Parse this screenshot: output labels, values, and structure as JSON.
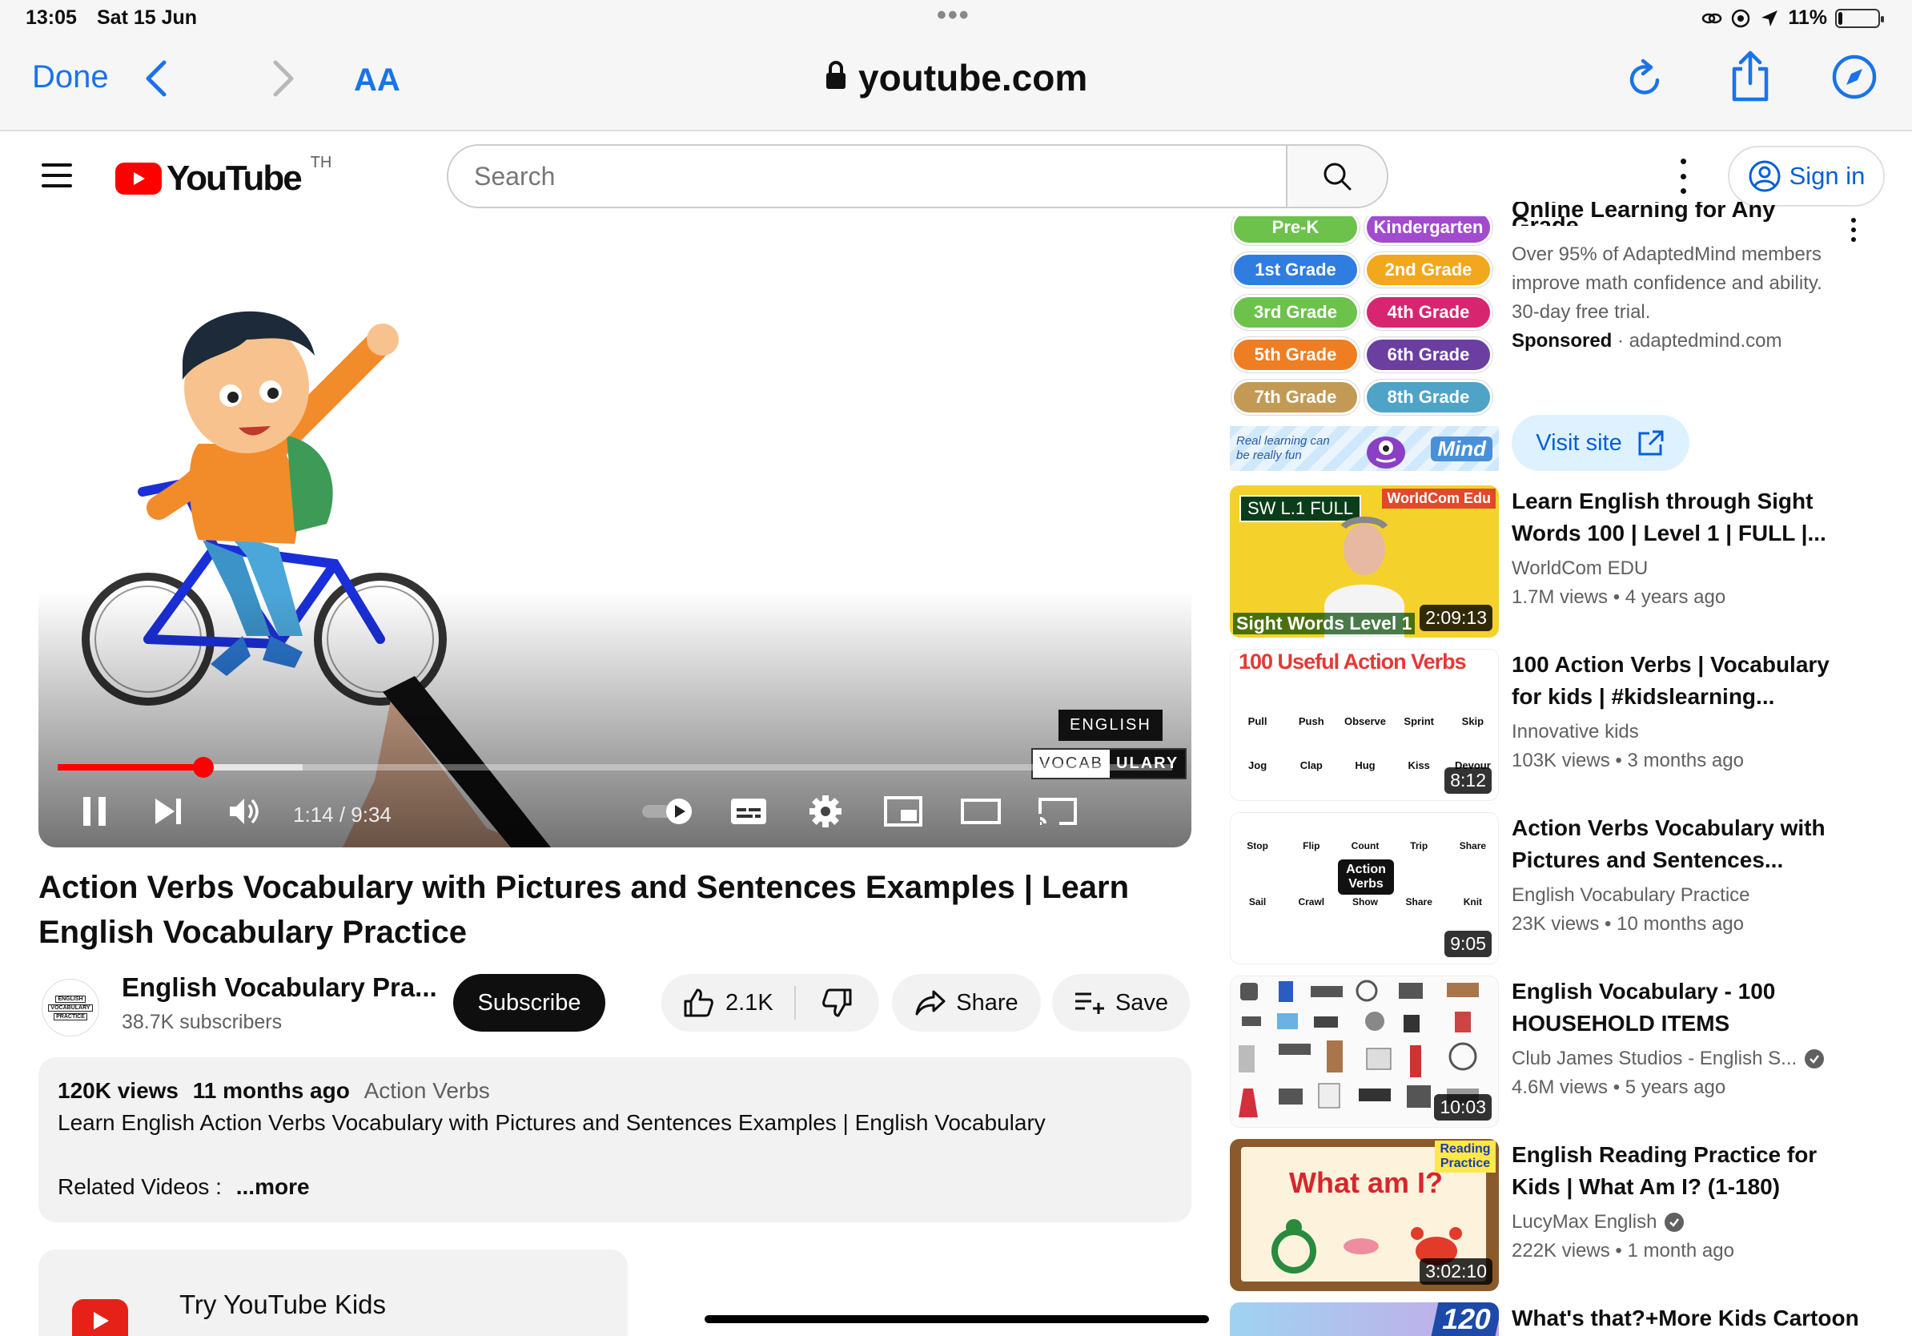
{
  "status": {
    "time": "13:05",
    "date": "Sat 15 Jun",
    "battery": "11%",
    "battery_level": 0.11
  },
  "safari": {
    "done": "Done",
    "text_size": "AA",
    "url": "youtube.com"
  },
  "yt": {
    "logo_text": "YouTube",
    "country": "TH",
    "search_placeholder": "Search",
    "sign_in": "Sign in"
  },
  "player": {
    "time": "1:14 / 9:34",
    "progress": 0.131,
    "badge_english": "ENGLISH",
    "badge_vocab_a": "VOCAB",
    "badge_vocab_b": "ULARY"
  },
  "video": {
    "title": "Action Verbs Vocabulary with Pictures and Sentences Examples | Learn English Vocabulary Practice",
    "channel": "English Vocabulary Pra...",
    "subscribers": "38.7K subscribers",
    "subscribe": "Subscribe",
    "likes": "2.1K",
    "share": "Share",
    "save": "Save",
    "views": "120K views",
    "age": "11 months ago",
    "hashtag": "Action Verbs",
    "description": "Learn English Action Verbs Vocabulary with Pictures and Sentences Examples | English Vocabulary",
    "related_label": "Related Videos :",
    "more": "...more",
    "avatar_lines": [
      "ENGLISH",
      "VOCABULARY",
      "PRACTICE"
    ]
  },
  "kids": {
    "label": "Try YouTube Kids"
  },
  "ad": {
    "title": "Online Learning for Any Grade",
    "description": "Over 95% of AdaptedMind members improve math confidence and ability. 30-day free trial.",
    "sponsored": "Sponsored",
    "domain": "adaptedmind.com",
    "visit": "Visit site",
    "banner_left": "Real learning can be really fun",
    "banner_right": "Mind",
    "grades": [
      "Pre-K",
      "Kindergarten",
      "1st Grade",
      "2nd Grade",
      "3rd Grade",
      "4th Grade",
      "5th Grade",
      "6th Grade",
      "7th Grade",
      "8th Grade"
    ],
    "grade_colors": [
      "#6cc24a",
      "#a24bcf",
      "#2f7de1",
      "#f2a81d",
      "#6cc24a",
      "#d7266f",
      "#ef7d22",
      "#6a3fa0",
      "#c29a55",
      "#4fa3c7"
    ]
  },
  "recommendations": [
    {
      "title": "Learn English through Sight Words 100 | Level 1 | FULL |...",
      "channel": "WorldCom EDU",
      "verified": false,
      "views": "1.7M views",
      "age": "4 years ago",
      "duration": "2:09:13",
      "thumb_top": "SW L.1 FULL",
      "thumb_badge": "WorldCom Edu",
      "thumb_bottom": "Sight Words Level 1"
    },
    {
      "title": "100 Action Verbs | Vocabulary for kids | #kidslearning...",
      "channel": "Innovative kids",
      "verified": false,
      "views": "103K views",
      "age": "3 months ago",
      "duration": "8:12",
      "thumb_top": "100 Useful Action Verbs",
      "thumb_words": [
        "Pull",
        "Push",
        "Observe",
        "Sprint",
        "Skip",
        "Jog",
        "Clap",
        "Hug",
        "Kiss",
        "Devour"
      ]
    },
    {
      "title": "Action Verbs Vocabulary with Pictures and Sentences...",
      "channel": "English Vocabulary Practice",
      "verified": false,
      "views": "23K views",
      "age": "10 months ago",
      "duration": "9:05",
      "thumb_center": "Action Verbs",
      "thumb_words": [
        "Stop",
        "Flip",
        "Count",
        "Trip",
        "Share",
        "Sail",
        "Crawl",
        "Show",
        "Share",
        "Knit"
      ]
    },
    {
      "title": "English Vocabulary - 100 HOUSEHOLD ITEMS",
      "channel": "Club James Studios - English S...",
      "verified": true,
      "views": "4.6M views",
      "age": "5 years ago",
      "duration": "10:03"
    },
    {
      "title": "English Reading Practice for Kids | What Am I? (1-180)",
      "channel": "LucyMax English",
      "verified": true,
      "views": "222K views",
      "age": "1 month ago",
      "duration": "3:02:10",
      "thumb_center": "What am I?",
      "thumb_badge": "Reading Practice"
    },
    {
      "title": "What's that?+More Kids Cartoon",
      "thumb_number": "120"
    }
  ]
}
